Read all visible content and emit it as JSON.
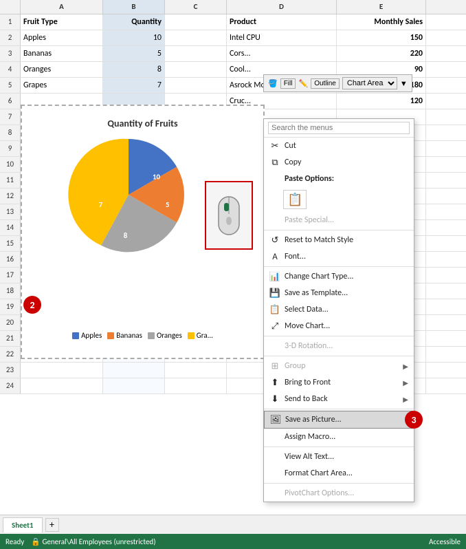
{
  "columns": {
    "headers": [
      "",
      "A",
      "B",
      "C",
      "D",
      "E"
    ]
  },
  "rows": [
    {
      "num": "1",
      "a": "Fruit Type",
      "b": "Quantity",
      "c": "",
      "d": "Product",
      "e": "Monthly Sales",
      "isHeader": true
    },
    {
      "num": "2",
      "a": "Apples",
      "b": "10",
      "c": "",
      "d": "Intel CPU",
      "e": "150"
    },
    {
      "num": "3",
      "a": "Bananas",
      "b": "5",
      "c": "",
      "d": "Cors...",
      "e": "220"
    },
    {
      "num": "4",
      "a": "Oranges",
      "b": "8",
      "c": "",
      "d": "Cool...",
      "e": "90"
    },
    {
      "num": "5",
      "a": "Grapes",
      "b": "7",
      "c": "",
      "d": "Asrock Motherboard",
      "e": "180"
    },
    {
      "num": "6",
      "a": "",
      "b": "",
      "c": "",
      "d": "Cruc...",
      "e": "120"
    }
  ],
  "chart": {
    "title": "Quantity of Fruits",
    "legend": [
      {
        "label": "Apples",
        "color": "#4472c4"
      },
      {
        "label": "Bananas",
        "color": "#ed7d31"
      },
      {
        "label": "Oranges",
        "color": "#a5a5a5"
      },
      {
        "label": "Gra...",
        "color": "#ffc000"
      }
    ],
    "values": [
      10,
      5,
      8,
      7
    ],
    "labels": [
      "10",
      "5",
      "8",
      "7"
    ]
  },
  "toolbar": {
    "fill_label": "Fill",
    "outline_label": "Outline",
    "chart_area_label": "Chart Area"
  },
  "context_menu": {
    "search_placeholder": "Search the menus",
    "items": [
      {
        "label": "Cut",
        "icon": "✂",
        "disabled": false,
        "has_arrow": false
      },
      {
        "label": "Copy",
        "icon": "⧉",
        "disabled": false,
        "has_arrow": false
      },
      {
        "label": "Paste Options:",
        "icon": "",
        "disabled": false,
        "has_arrow": false,
        "is_section": true
      },
      {
        "label": "Paste Special...",
        "icon": "",
        "disabled": true,
        "has_arrow": false
      },
      {
        "label": "Reset to Match Style",
        "icon": "↺",
        "disabled": false,
        "has_arrow": false
      },
      {
        "label": "Font...",
        "icon": "A",
        "disabled": false,
        "has_arrow": false
      },
      {
        "label": "Change Chart Type...",
        "icon": "📊",
        "disabled": false,
        "has_arrow": false
      },
      {
        "label": "Save as Template...",
        "icon": "💾",
        "disabled": false,
        "has_arrow": false
      },
      {
        "label": "Select Data...",
        "icon": "📋",
        "disabled": false,
        "has_arrow": false
      },
      {
        "label": "Move Chart...",
        "icon": "⤢",
        "disabled": false,
        "has_arrow": false
      },
      {
        "label": "3-D Rotation...",
        "icon": "",
        "disabled": true,
        "has_arrow": false
      },
      {
        "label": "Group",
        "icon": "⊞",
        "disabled": true,
        "has_arrow": true
      },
      {
        "label": "Bring to Front",
        "icon": "⬆",
        "disabled": false,
        "has_arrow": true
      },
      {
        "label": "Send to Back",
        "icon": "⬇",
        "disabled": false,
        "has_arrow": true
      },
      {
        "label": "Save as Picture...",
        "icon": "🖼",
        "disabled": false,
        "has_arrow": false,
        "highlighted": true
      },
      {
        "label": "Assign Macro...",
        "icon": "",
        "disabled": false,
        "has_arrow": false
      },
      {
        "label": "View Alt Text...",
        "icon": "",
        "disabled": false,
        "has_arrow": false
      },
      {
        "label": "Format Chart Area...",
        "icon": "",
        "disabled": false,
        "has_arrow": false
      },
      {
        "label": "PivotChart Options...",
        "icon": "",
        "disabled": true,
        "has_arrow": false
      }
    ]
  },
  "status_bar": {
    "ready": "Ready",
    "security": "🔒 General\\All Employees (unrestricted)",
    "accessible": "Accessible"
  },
  "sheet_tab": "Sheet1",
  "extra_rows": [
    "7",
    "8",
    "9",
    "10",
    "11",
    "12",
    "13",
    "14",
    "15",
    "16",
    "17",
    "18",
    "19",
    "20",
    "21",
    "22",
    "23",
    "24"
  ]
}
